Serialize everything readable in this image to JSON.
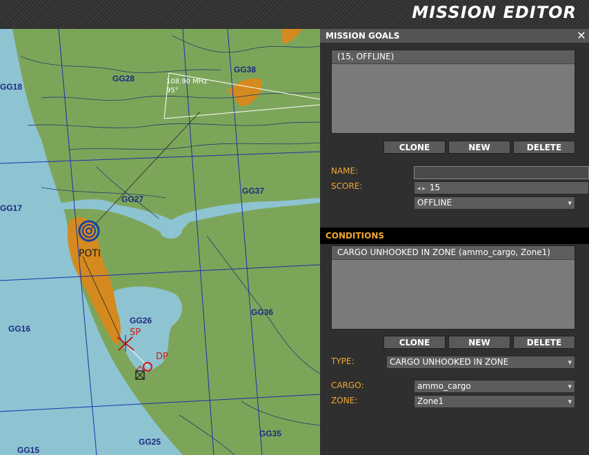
{
  "window": {
    "title": "MISSION EDITOR"
  },
  "map": {
    "grid_labels": [
      "GG18",
      "GG28",
      "GG38",
      "GG17",
      "GG27",
      "GG37",
      "GG16",
      "GG26",
      "GG36",
      "GG15",
      "GG25",
      "GG35"
    ],
    "city": "POTI",
    "beacon_freq": "108.90 MHz",
    "beacon_heading": "95°",
    "sp_label": "SP",
    "dp_label": "DP"
  },
  "goals": {
    "header": "MISSION GOALS",
    "close_glyph": "✕",
    "items": [
      "(15, OFFLINE)"
    ],
    "buttons": {
      "clone": "CLONE",
      "new": "NEW",
      "delete": "DELETE"
    },
    "name_label": "NAME:",
    "name_value": "",
    "score_label": "SCORE:",
    "score_value": "15",
    "mode_value": "OFFLINE"
  },
  "conditions": {
    "header": "CONDITIONS",
    "items": [
      "CARGO UNHOOKED IN ZONE (ammo_cargo, Zone1)"
    ],
    "buttons": {
      "clone": "CLONE",
      "new": "NEW",
      "delete": "DELETE"
    },
    "type_label": "TYPE:",
    "type_value": "CARGO UNHOOKED IN ZONE",
    "cargo_label": "CARGO:",
    "cargo_value": "ammo_cargo",
    "zone_label": "ZONE:",
    "zone_value": "Zone1"
  },
  "colors": {
    "accent": "#f0a830",
    "land": "#7da55a",
    "water": "#8ec3d2",
    "urban": "#d48a1e",
    "grid": "#1c2fa8"
  }
}
